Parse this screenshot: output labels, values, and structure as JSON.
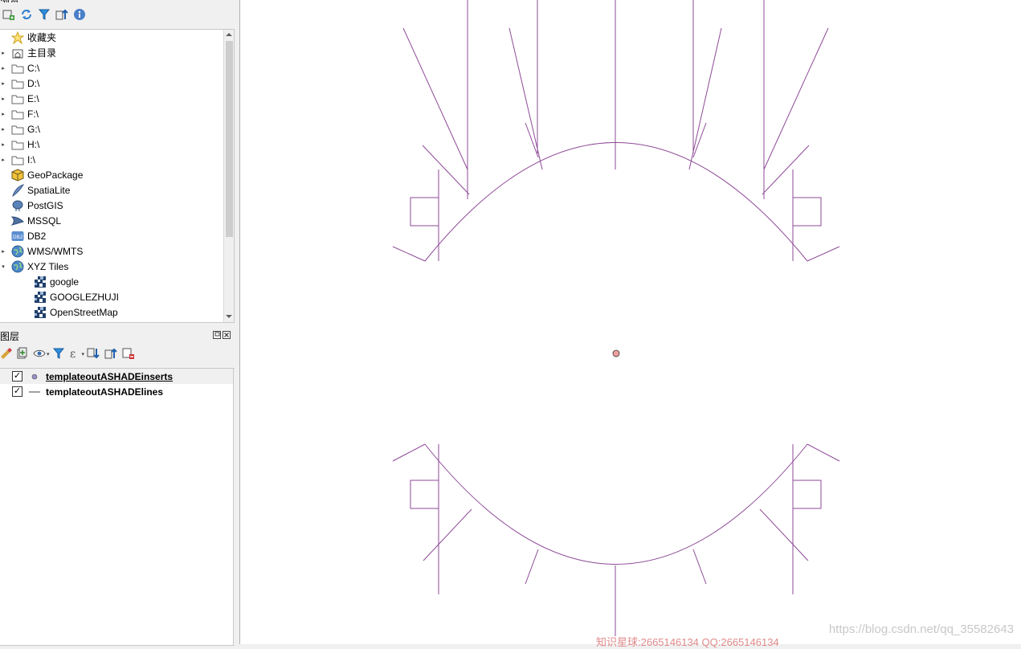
{
  "browser_panel": {
    "title": "浏览",
    "tree": [
      {
        "label": "收藏夹",
        "icon": "star-icon",
        "arrow": ""
      },
      {
        "label": "主目录",
        "icon": "home-folder-icon",
        "arrow": "▸"
      },
      {
        "label": "C:\\",
        "icon": "folder-icon",
        "arrow": "▸"
      },
      {
        "label": "D:\\",
        "icon": "folder-icon",
        "arrow": "▸"
      },
      {
        "label": "E:\\",
        "icon": "folder-icon",
        "arrow": "▸"
      },
      {
        "label": "F:\\",
        "icon": "folder-icon",
        "arrow": "▸"
      },
      {
        "label": "G:\\",
        "icon": "folder-icon",
        "arrow": "▸"
      },
      {
        "label": "H:\\",
        "icon": "folder-icon",
        "arrow": "▸"
      },
      {
        "label": "I:\\",
        "icon": "folder-icon",
        "arrow": "▸"
      },
      {
        "label": "GeoPackage",
        "icon": "geopackage-icon",
        "arrow": ""
      },
      {
        "label": "SpatiaLite",
        "icon": "spatialite-icon",
        "arrow": ""
      },
      {
        "label": "PostGIS",
        "icon": "postgis-icon",
        "arrow": ""
      },
      {
        "label": "MSSQL",
        "icon": "mssql-icon",
        "arrow": ""
      },
      {
        "label": "DB2",
        "icon": "db2-icon",
        "arrow": ""
      },
      {
        "label": "WMS/WMTS",
        "icon": "globe-icon",
        "arrow": "▸"
      },
      {
        "label": "XYZ Tiles",
        "icon": "globe-icon",
        "arrow": "▾"
      },
      {
        "label": "google",
        "icon": "xyz-tile-icon",
        "arrow": "",
        "child": true
      },
      {
        "label": "GOOGLEZHUJI",
        "icon": "xyz-tile-icon",
        "arrow": "",
        "child": true
      },
      {
        "label": "OpenStreetMap",
        "icon": "xyz-tile-icon",
        "arrow": "",
        "child": true
      }
    ]
  },
  "layers_panel": {
    "title": "图层",
    "layers": [
      {
        "name": "templateoutASHADEinserts",
        "checked": true,
        "symbol": "point-symbol-icon"
      },
      {
        "name": "templateoutASHADElines",
        "checked": true,
        "symbol": "line-symbol-icon"
      }
    ]
  },
  "map": {
    "line_color": "#8e4a97",
    "point_fill": "#f2a0a0"
  },
  "watermark": {
    "text": "https://blog.csdn.net/qq_35582643",
    "text2": "知识星球:2665146134 QQ:2665146134"
  }
}
